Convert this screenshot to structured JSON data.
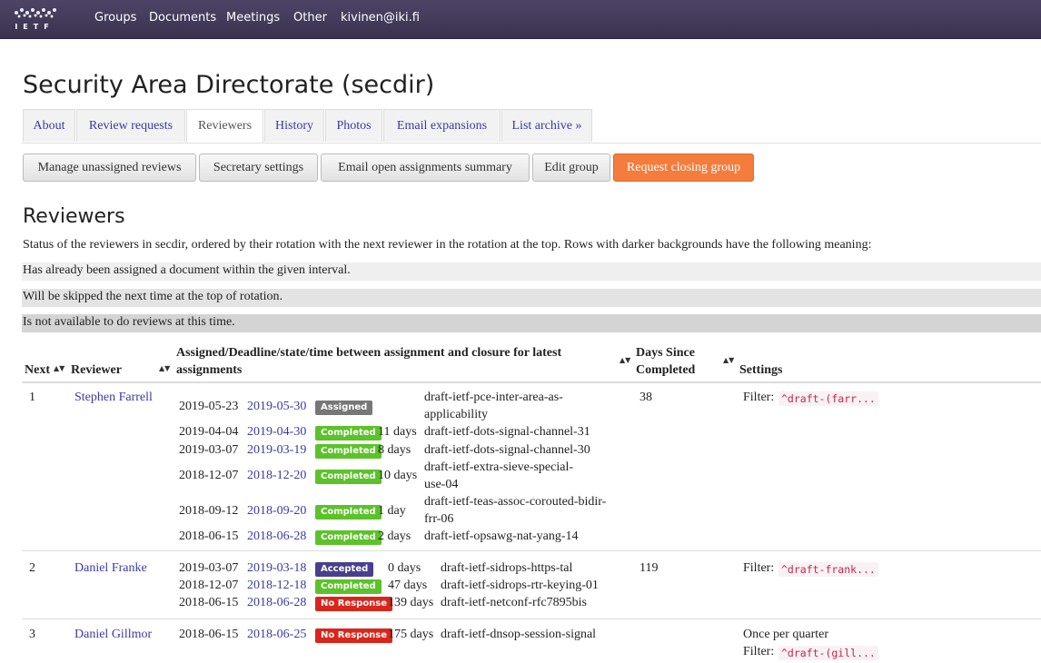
{
  "nav": {
    "logo_text": "IETF",
    "items": [
      "Groups",
      "Documents",
      "Meetings",
      "Other",
      "kivinen@iki.fi"
    ]
  },
  "page_title": "Security Area Directorate (secdir)",
  "tabs": [
    "About",
    "Review requests",
    "Reviewers",
    "History",
    "Photos",
    "Email expansions",
    "List archive »"
  ],
  "actions": [
    "Manage unassigned reviews",
    "Secretary settings",
    "Email open assignments summary",
    "Edit group",
    "Request closing group"
  ],
  "section_title": "Reviewers",
  "intro": "Status of the reviewers in secdir, ordered by their rotation with the next reviewer in the rotation at the top. Rows with darker backgrounds have the following meaning:",
  "legend": [
    {
      "text": "Has already been assigned a document within the given interval.",
      "color": "#efefef"
    },
    {
      "text": "Will be skipped the next time at the top of rotation.",
      "color": "#e3e3e3"
    },
    {
      "text": "Is not available to do reviews at this time.",
      "color": "#d4d4d4"
    }
  ],
  "table": {
    "headers": {
      "next": "Next",
      "reviewer": "Reviewer",
      "assign_1": "Assigned/Deadline/state/time between assignment and closure for latest",
      "assign_2": "assignments",
      "days_1": "Days Since",
      "days_2": "Completed",
      "settings": "Settings"
    },
    "sort_icon": "sort-icon",
    "rows": [
      {
        "next": "1",
        "reviewer": "Stephen Farrell",
        "days": "38",
        "filter_label": "Filter:",
        "filter": "^draft-(farr...",
        "assignments": [
          {
            "assigned": "2019-05-23",
            "deadline": "2019-05-30",
            "state": "Assigned",
            "time": "",
            "doc_1": "draft-ietf-pce-inter-area-as-",
            "doc_2": "applicability"
          },
          {
            "assigned": "2019-04-04",
            "deadline": "2019-04-30",
            "state": "Completed",
            "time": "11 days",
            "doc_1": "draft-ietf-dots-signal-channel-31",
            "doc_2": ""
          },
          {
            "assigned": "2019-03-07",
            "deadline": "2019-03-19",
            "state": "Completed",
            "time": "8 days",
            "doc_1": "draft-ietf-dots-signal-channel-30",
            "doc_2": ""
          },
          {
            "assigned": "2018-12-07",
            "deadline": "2018-12-20",
            "state": "Completed",
            "time": "10 days",
            "doc_1": "draft-ietf-extra-sieve-special-",
            "doc_2": "use-04"
          },
          {
            "assigned": "2018-09-12",
            "deadline": "2018-09-20",
            "state": "Completed",
            "time": "1 day",
            "doc_1": "draft-ietf-teas-assoc-corouted-bidir-",
            "doc_2": "frr-06"
          },
          {
            "assigned": "2018-06-15",
            "deadline": "2018-06-28",
            "state": "Completed",
            "time": "2 days",
            "doc_1": "draft-ietf-opsawg-nat-yang-14",
            "doc_2": ""
          }
        ]
      },
      {
        "next": "2",
        "reviewer": "Daniel Franke",
        "days": "119",
        "filter_label": "Filter:",
        "filter": "^draft-frank...",
        "assignments": [
          {
            "assigned": "2019-03-07",
            "deadline": "2019-03-18",
            "state": "Accepted",
            "time": "0 days",
            "doc_1": "draft-ietf-sidrops-https-tal"
          },
          {
            "assigned": "2018-12-07",
            "deadline": "2018-12-18",
            "state": "Completed",
            "time": "47 days",
            "doc_1": "draft-ietf-sidrops-rtr-keying-01"
          },
          {
            "assigned": "2018-06-15",
            "deadline": "2018-06-28",
            "state": "No Response",
            "time": "139 days",
            "doc_1": "draft-ietf-netconf-rfc7895bis"
          }
        ]
      },
      {
        "next": "3",
        "reviewer": "Daniel Gillmor",
        "days": "",
        "frequency": "Once per quarter",
        "filter_label": "Filter:",
        "filter": "^draft-(gill...",
        "assignments": [
          {
            "assigned": "2018-06-15",
            "deadline": "2018-06-25",
            "state": "No Response",
            "time": "175 days",
            "doc_1": "draft-ietf-dnsop-session-signal"
          }
        ]
      }
    ]
  },
  "colors": {
    "navbar": "#3f3756",
    "link": "#3a3aa5",
    "assigned": "#777777",
    "completed": "#5cc22a",
    "accepted": "#4a3f8c",
    "no_response": "#d9261c",
    "warn_button": "#f47c3c"
  }
}
